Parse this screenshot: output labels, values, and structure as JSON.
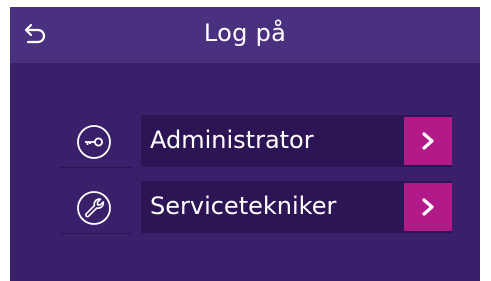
{
  "header": {
    "title": "Log på",
    "back_icon": "back-arrow-icon"
  },
  "options": [
    {
      "label": "Administrator",
      "icon": "key-icon"
    },
    {
      "label": "Servicetekniker",
      "icon": "wrench-icon"
    }
  ],
  "colors": {
    "background": "#3a1f6b",
    "header": "#4a3180",
    "button": "#2d1555",
    "accent": "#b21a8a",
    "text": "#ffffff"
  }
}
